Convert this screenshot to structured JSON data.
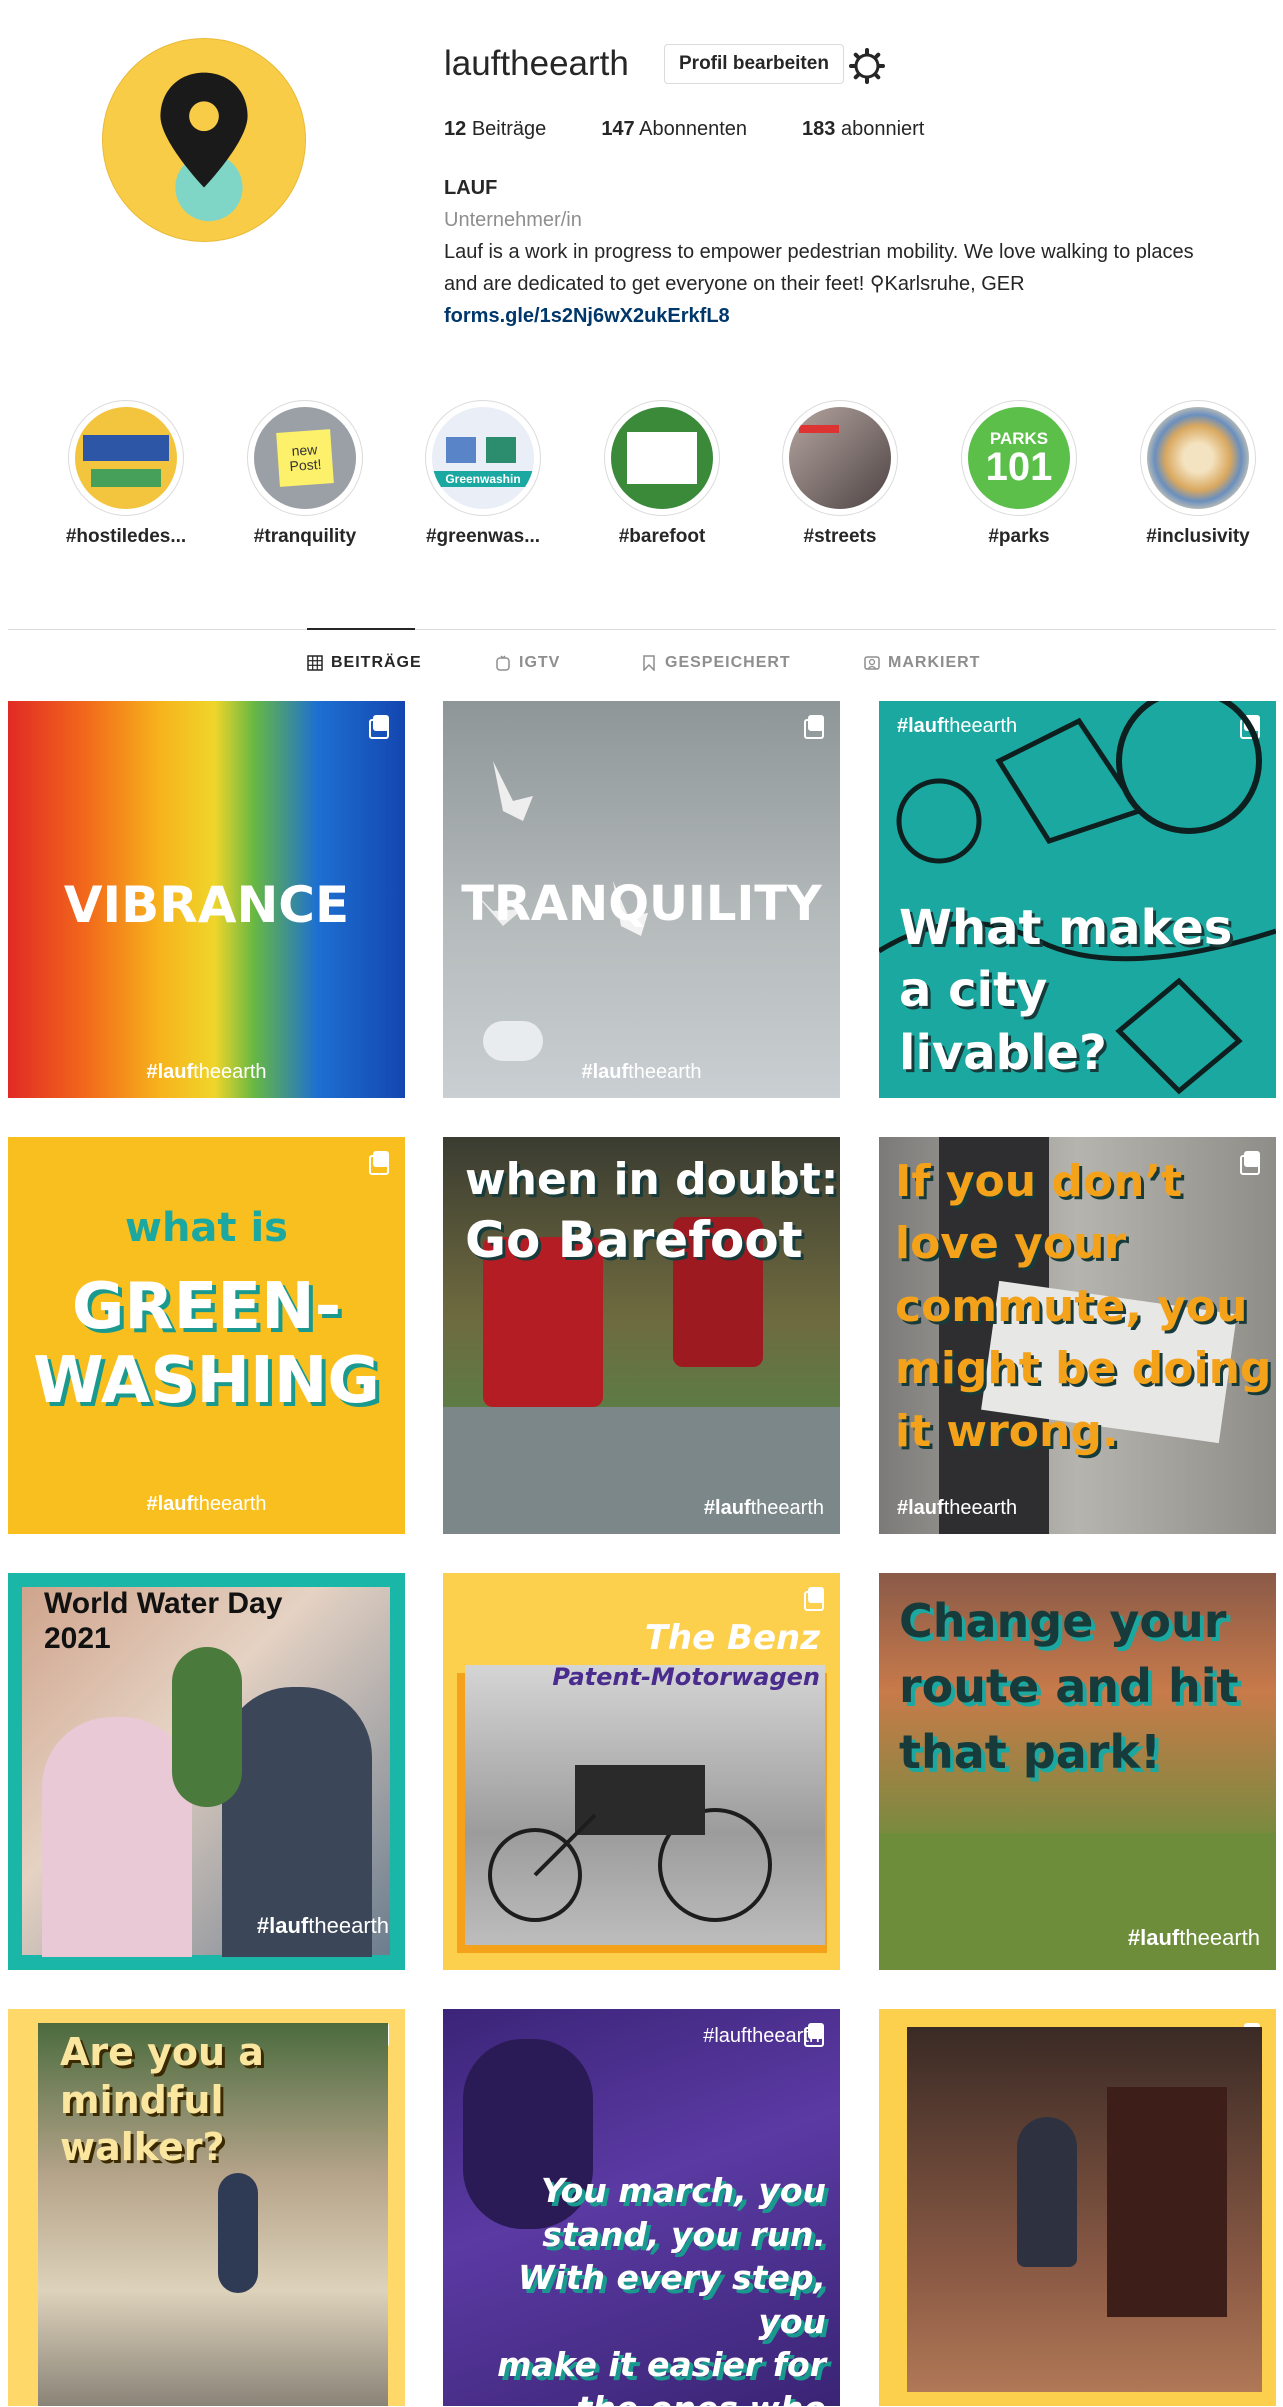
{
  "profile": {
    "username": "lauftheearth",
    "edit_label": "Profil bearbeiten",
    "posts_count": "12",
    "posts_label": "Beiträge",
    "followers_count": "147",
    "followers_label": "Abonnenten",
    "following_count": "183",
    "following_label": "abonniert",
    "display_name": "LAUF",
    "category": "Unternehmer/in",
    "bio_line1": "Lauf is a work in progress to empower pedestrian mobility. We love walking to places",
    "bio_line2": "and are dedicated to get everyone on their feet! ⚲Karlsruhe, GER",
    "link": "forms.gle/1s2Nj6wX2ukErkfL8"
  },
  "highlights": [
    {
      "label": "#hostiledes...",
      "color": "#f3c53e"
    },
    {
      "label": "#tranquility",
      "color": "#9aa0a6",
      "inner": "new Post!"
    },
    {
      "label": "#greenwas...",
      "color": "#e9eef7",
      "inner": "Greenwashin"
    },
    {
      "label": "#barefoot",
      "color": "#3a8a3a"
    },
    {
      "label": "#streets",
      "color": "#7b6a6a"
    },
    {
      "label": "#parks",
      "color": "#5bbf4a",
      "inner1": "PARKS",
      "inner2": "101"
    },
    {
      "label": "#inclusivity",
      "color": "#e4c79a"
    }
  ],
  "tabs": {
    "posts": "BEITRÄGE",
    "igtv": "IGTV",
    "saved": "GESPEICHERT",
    "tagged": "MARKIERT"
  },
  "hashtag": {
    "bold": "lauf",
    "light": "theearth"
  },
  "posts": {
    "p1": "VIBRANCE",
    "p2": "TRANQUILITY",
    "p3_line1": "What makes",
    "p3_line2": "a city",
    "p3_line3": "livable?",
    "p4_line1": "what is",
    "p4_line2": "GREEN-",
    "p4_line3": "WASHING",
    "p5_line1": "when in doubt:",
    "p5_line2": "Go Barefoot",
    "p6_line1": "If you don’t",
    "p6_line2": "love your",
    "p6_line3": "commute, you",
    "p6_line4": "might be doing",
    "p6_line5": "it wrong.",
    "p7_line1": "World Water Day",
    "p7_line2": "2021",
    "p8_line1": "The Benz",
    "p8_line2": "Patent-Motorwagen",
    "p9_line1": "Change your",
    "p9_line2": "route and hit",
    "p9_line3": "that park!",
    "p10_line1": "Are you a",
    "p10_line2": "mindful",
    "p10_line3": "walker?",
    "p11_line1": "You march, you",
    "p11_line2": "stand, you run.",
    "p11_line3": "With every step, you",
    "p11_line4": "make it easier for",
    "p11_line5": "the ones who follow."
  },
  "colors": {
    "brand_yellow": "#f9cc47",
    "teal": "#1ba8a0",
    "purple": "#4a2c8f",
    "orange": "#f4a21a"
  }
}
